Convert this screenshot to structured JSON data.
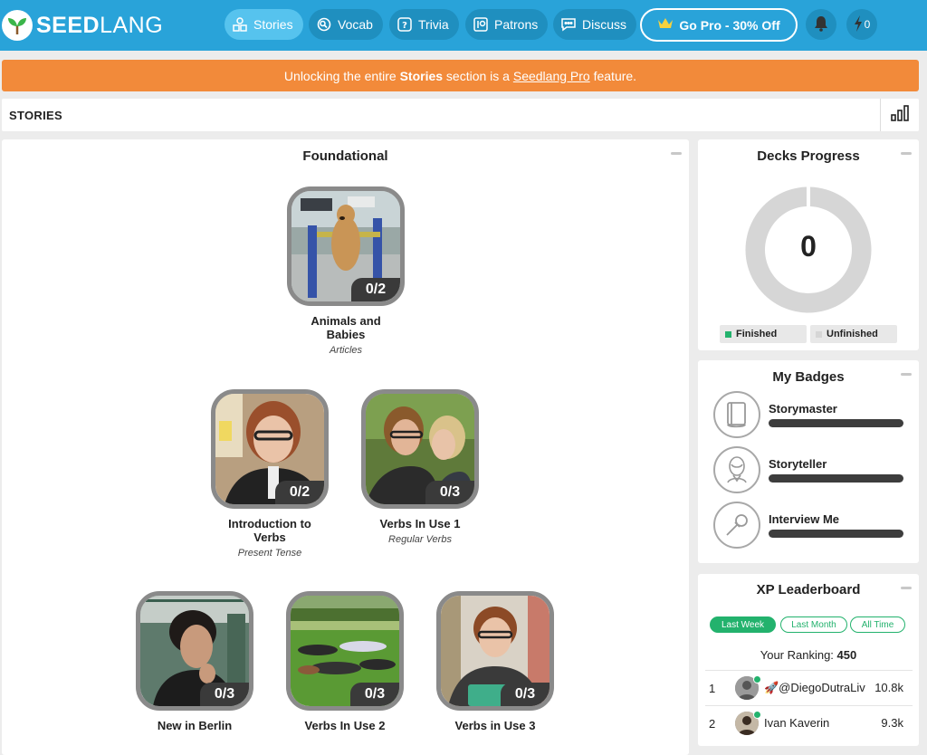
{
  "nav": {
    "logo_bold": "SEED",
    "logo_light": "LANG",
    "items": [
      {
        "label": "Stories",
        "icon": "stories-icon",
        "active": true
      },
      {
        "label": "Vocab",
        "icon": "vocab-icon",
        "active": false
      },
      {
        "label": "Trivia",
        "icon": "trivia-icon",
        "active": false
      },
      {
        "label": "Patrons",
        "icon": "patrons-icon",
        "active": false
      },
      {
        "label": "Discuss",
        "icon": "discuss-icon",
        "active": false
      }
    ],
    "pro_label": "Go Pro - 30% Off",
    "energy_count": "0"
  },
  "banner": {
    "prefix": "Unlocking the entire ",
    "bold": "Stories",
    "middle": " section is a ",
    "link": "Seedlang Pro",
    "suffix": " feature."
  },
  "stories_bar": {
    "title": "STORIES"
  },
  "main": {
    "section_title": "Foundational",
    "stories": [
      {
        "name": "Animals and Babies",
        "sub": "Articles",
        "progress": "0/2"
      },
      {
        "name": "Introduction to Verbs",
        "sub": "Present Tense",
        "progress": "0/2"
      },
      {
        "name": "Verbs In Use 1",
        "sub": "Regular Verbs",
        "progress": "0/3"
      },
      {
        "name": "New in Berlin",
        "sub": "",
        "progress": "0/3"
      },
      {
        "name": "Verbs In Use 2",
        "sub": "",
        "progress": "0/3"
      },
      {
        "name": "Verbs in Use 3",
        "sub": "",
        "progress": "0/3"
      }
    ]
  },
  "decks": {
    "title": "Decks Progress",
    "count": "0",
    "finished_label": "Finished",
    "unfinished_label": "Unfinished",
    "finished_color": "#23b26d",
    "unfinished_color": "#d6d6d6"
  },
  "badges": {
    "title": "My Badges",
    "items": [
      {
        "name": "Storymaster",
        "icon": "book-icon"
      },
      {
        "name": "Storyteller",
        "icon": "shakespeare-icon"
      },
      {
        "name": "Interview Me",
        "icon": "microphone-icon"
      }
    ]
  },
  "leaderboard": {
    "title": "XP Leaderboard",
    "tabs": [
      "Last Week",
      "Last Month",
      "All Time"
    ],
    "ranking_label": "Your Ranking: ",
    "ranking_value": "450",
    "rows": [
      {
        "rank": "1",
        "name": "🚀@DiegoDutraLiv",
        "xp": "10.8k"
      },
      {
        "rank": "2",
        "name": "Ivan Kaverin",
        "xp": "9.3k"
      }
    ]
  }
}
